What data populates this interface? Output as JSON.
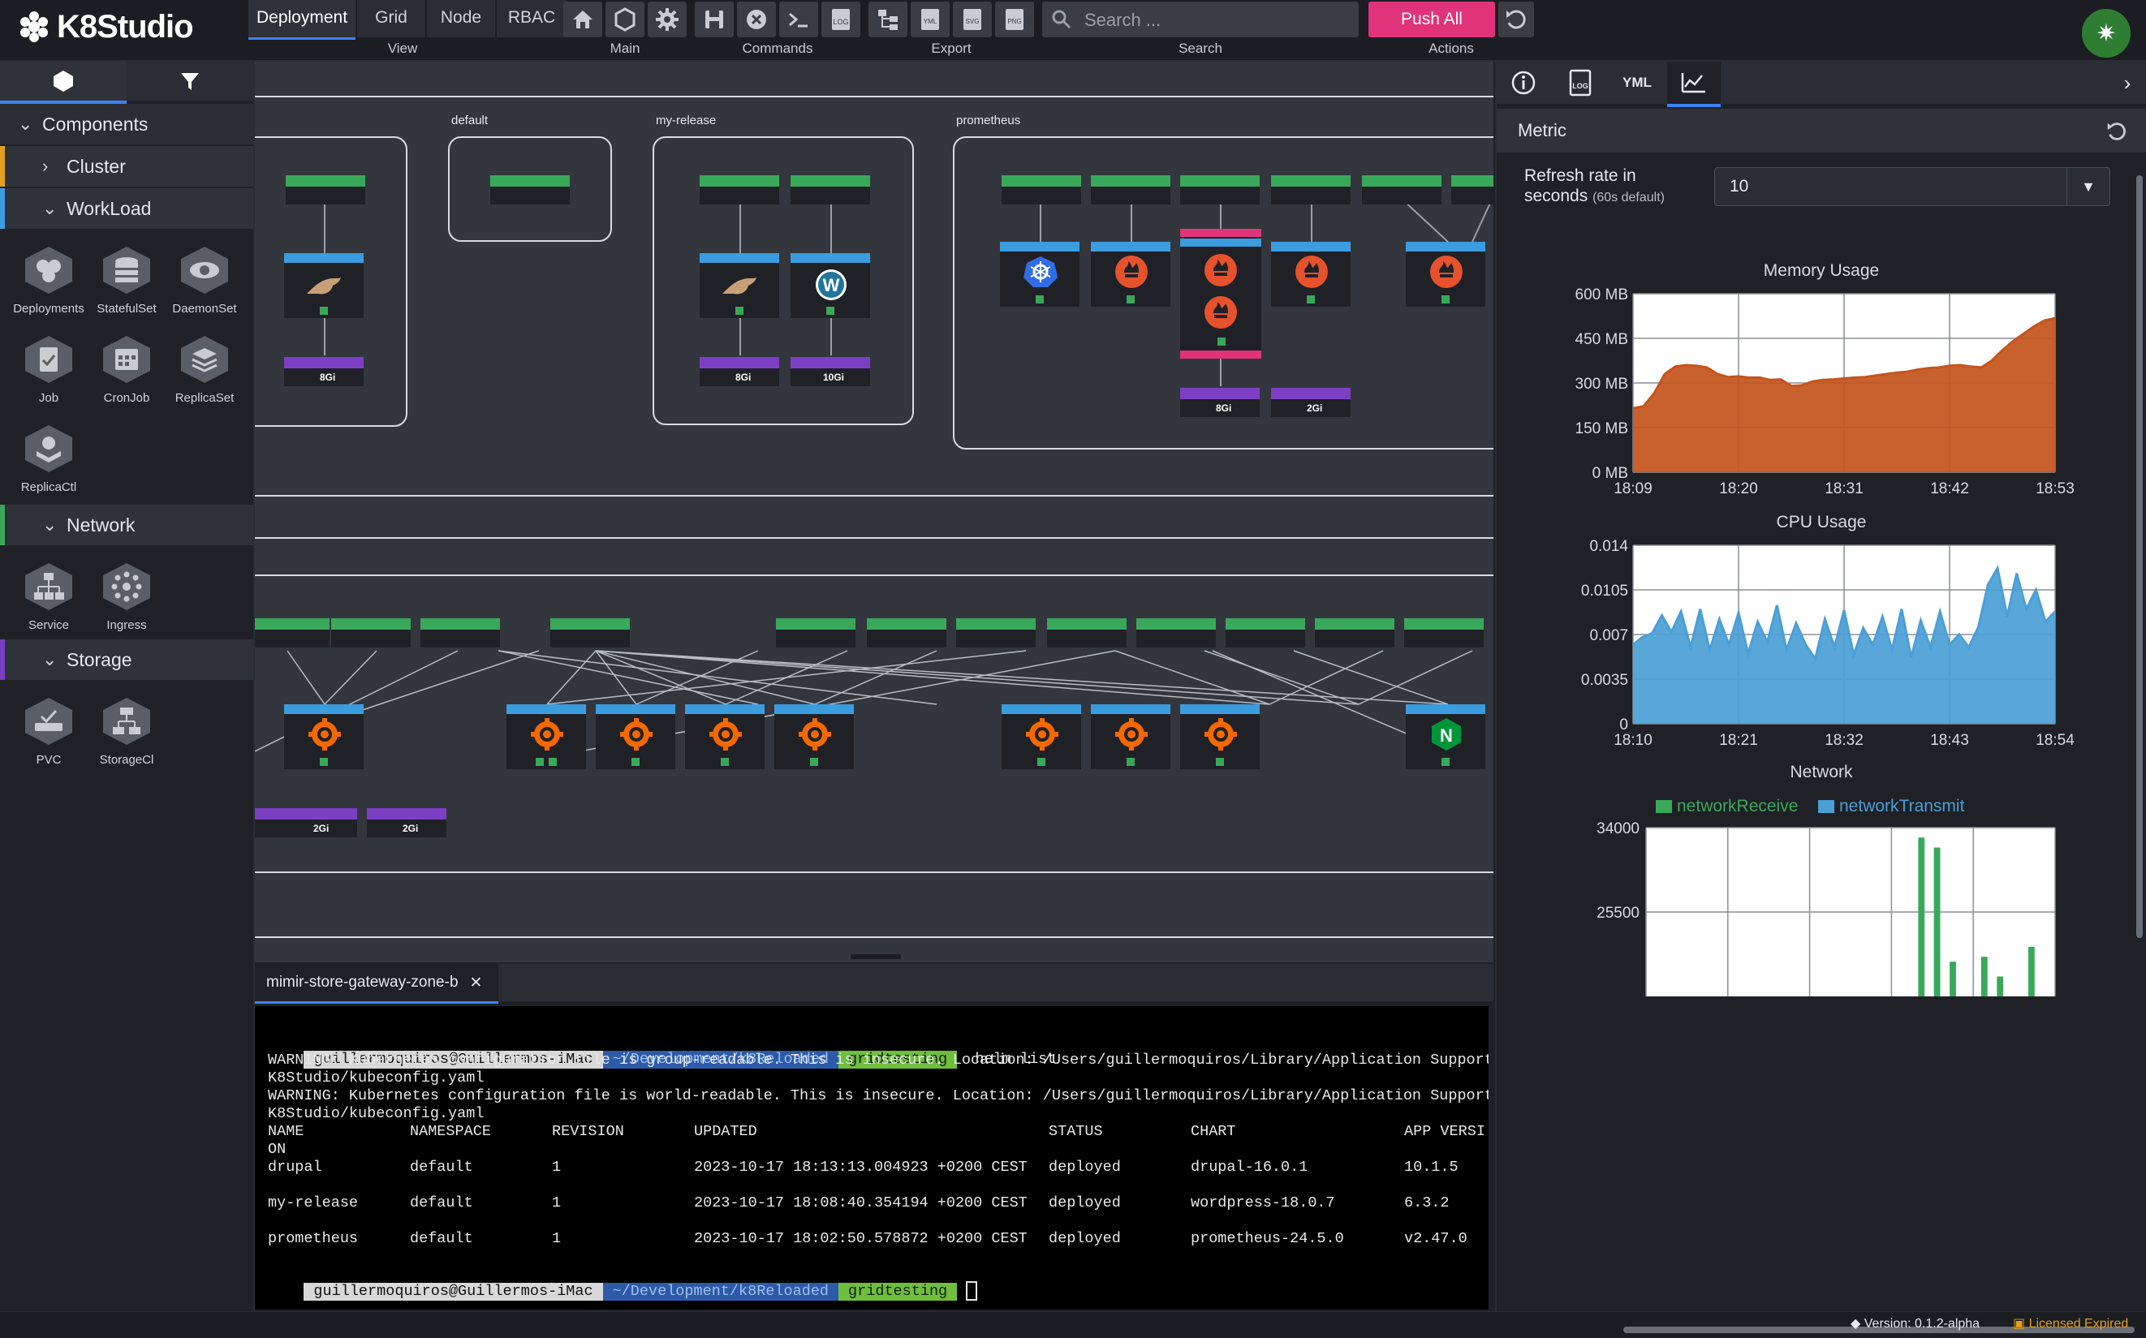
{
  "app": {
    "name": "K8Studio"
  },
  "toolbar": {
    "groups": {
      "view": "View",
      "main": "Main",
      "commands": "Commands",
      "export": "Export",
      "search": "Search",
      "actions": "Actions"
    },
    "view_tabs": [
      "Deployment",
      "Grid",
      "Node",
      "RBAC"
    ],
    "export_labels": {
      "yml": "YML",
      "svg": "SVG",
      "png": "PNG",
      "log": "LOG"
    },
    "search_placeholder": "Search ...",
    "push_all": "Push All"
  },
  "sidebar": {
    "components": "Components",
    "cluster": "Cluster",
    "workload": "WorkLoad",
    "network": "Network",
    "storage": "Storage",
    "workload_items": [
      "Deployments",
      "StatefulSet",
      "DaemonSet",
      "Job",
      "CronJob",
      "ReplicaSet",
      "ReplicaCtl"
    ],
    "network_items": [
      "Service",
      "Ingress"
    ],
    "storage_items": [
      "PVC",
      "StorageCl"
    ]
  },
  "canvas": {
    "namespaces": [
      "default",
      "my-release",
      "prometheus"
    ],
    "pvc_sizes": [
      "8Gi",
      "8Gi",
      "10Gi",
      "8Gi",
      "2Gi",
      "2Gi",
      "2Gi"
    ]
  },
  "terminal": {
    "tab_title": "mimir-store-gateway-zone-b",
    "prompt_user": "guillermoquiros@Guillermos-iMac",
    "prompt_path": "~/Development/k8Reloaded",
    "prompt_branch": "gridtesting",
    "command": "helm list",
    "warnings": [
      "WARNING: Kubernetes configuration file is group-readable. This is insecure. Location: /Users/guillermoquiros/Library/Application Support/",
      "K8Studio/kubeconfig.yaml",
      "WARNING: Kubernetes configuration file is world-readable. This is insecure. Location: /Users/guillermoquiros/Library/Application Support/",
      "K8Studio/kubeconfig.yaml"
    ],
    "columns": [
      "NAME",
      "NAMESPACE",
      "REVISION",
      "UPDATED",
      "STATUS",
      "CHART",
      "APP VERSI"
    ],
    "column_wrap": "ON",
    "rows": [
      [
        "drupal",
        "default",
        "1",
        "2023-10-17 18:13:13.004923 +0200 CEST",
        "deployed",
        "drupal-16.0.1",
        "10.1.5"
      ],
      [
        "my-release",
        "default",
        "1",
        "2023-10-17 18:08:40.354194 +0200 CEST",
        "deployed",
        "wordpress-18.0.7",
        "6.3.2"
      ],
      [
        "prometheus",
        "default",
        "1",
        "2023-10-17 18:02:50.578872 +0200 CEST",
        "deployed",
        "prometheus-24.5.0",
        "v2.47.0"
      ]
    ]
  },
  "right_panel": {
    "tabs": {
      "yml": "YML",
      "log": "LOG"
    },
    "metric_title": "Metric",
    "refresh_label": "Refresh rate in seconds",
    "refresh_hint": "(60s default)",
    "refresh_value": "10"
  },
  "chart_data": [
    {
      "type": "area",
      "title": "Memory Usage",
      "x_ticks": [
        "18:09",
        "18:20",
        "18:31",
        "18:42",
        "18:53"
      ],
      "y_ticks": [
        "0 MB",
        "150 MB",
        "300 MB",
        "450 MB",
        "600 MB"
      ],
      "ylim": [
        0,
        600
      ],
      "grid": true,
      "color": "#c4541d",
      "values": [
        215,
        222,
        265,
        330,
        355,
        360,
        358,
        352,
        330,
        320,
        322,
        318,
        318,
        310,
        312,
        290,
        292,
        305,
        310,
        312,
        315,
        318,
        320,
        325,
        330,
        335,
        338,
        345,
        350,
        352,
        358,
        360,
        355,
        352,
        375,
        410,
        440,
        465,
        490,
        510,
        518
      ]
    },
    {
      "type": "area",
      "title": "CPU Usage",
      "x_ticks": [
        "18:10",
        "18:21",
        "18:32",
        "18:43",
        "18:54"
      ],
      "y_ticks": [
        "0",
        "0.0035",
        "0.007",
        "0.0105",
        "0.014"
      ],
      "ylim": [
        0,
        0.014
      ],
      "grid": true,
      "color": "#4b9fd6",
      "values": [
        0.0062,
        0.0068,
        0.0071,
        0.0085,
        0.0072,
        0.0088,
        0.006,
        0.009,
        0.0058,
        0.0082,
        0.0062,
        0.0087,
        0.0055,
        0.008,
        0.0064,
        0.0093,
        0.0058,
        0.0079,
        0.0062,
        0.0051,
        0.0082,
        0.006,
        0.0089,
        0.0054,
        0.0075,
        0.0062,
        0.0084,
        0.0058,
        0.009,
        0.0052,
        0.0081,
        0.006,
        0.0088,
        0.0062,
        0.007,
        0.006,
        0.0076,
        0.0109,
        0.0122,
        0.0084,
        0.0118,
        0.009,
        0.0105,
        0.008,
        0.0088
      ]
    },
    {
      "type": "bar",
      "title": "Network",
      "legend": "top",
      "y_ticks": [
        "25500",
        "34000"
      ],
      "ylim": [
        17000,
        34000
      ],
      "grid": true,
      "series": [
        {
          "name": "networkReceive",
          "color": "#3aa85b",
          "values": [
            0,
            0,
            0,
            0,
            0,
            0,
            0,
            0,
            0,
            0,
            0,
            0,
            0,
            0,
            0,
            0,
            0,
            33000,
            32000,
            20500,
            0,
            21000,
            19000,
            0,
            22000,
            0
          ]
        },
        {
          "name": "networkTransmit",
          "color": "#4b9fd6",
          "values": []
        }
      ]
    }
  ],
  "status": {
    "version": "Version: 0.1.2-alpha",
    "license": "Licensed Expired"
  }
}
